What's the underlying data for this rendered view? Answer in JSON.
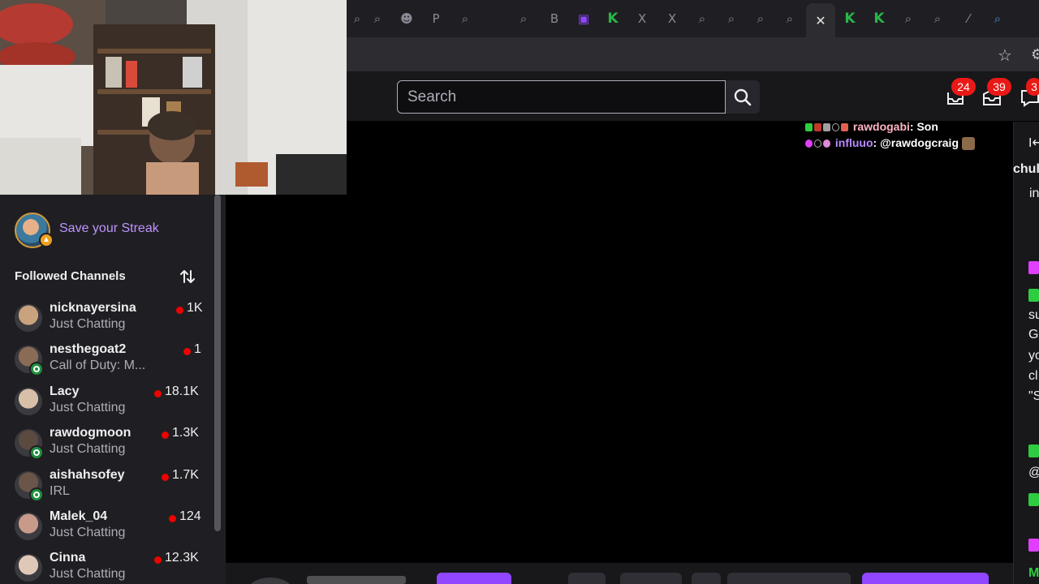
{
  "browser": {
    "tabs": [
      {
        "icon": "search-icon",
        "glyph": "⌕"
      },
      {
        "icon": "search-icon",
        "glyph": "⌕"
      },
      {
        "icon": "emoji-icon",
        "glyph": "☻"
      },
      {
        "icon": "p-icon",
        "glyph": "P"
      },
      {
        "icon": "search-icon",
        "glyph": "⌕"
      },
      {
        "icon": "search-icon",
        "glyph": "⌕"
      },
      {
        "icon": "bitcoin-icon",
        "glyph": "B"
      },
      {
        "icon": "twitch-icon",
        "glyph": "▣"
      },
      {
        "icon": "kick-icon",
        "glyph": "K"
      },
      {
        "icon": "x-icon",
        "glyph": "X"
      },
      {
        "icon": "x-icon",
        "glyph": "X"
      },
      {
        "icon": "search-icon",
        "glyph": "⌕"
      },
      {
        "icon": "search-icon",
        "glyph": "⌕"
      },
      {
        "icon": "search-icon",
        "glyph": "⌕"
      },
      {
        "icon": "search-icon",
        "glyph": "⌕"
      },
      {
        "icon": "close-icon",
        "glyph": "✕"
      },
      {
        "icon": "kick-icon",
        "glyph": "K"
      },
      {
        "icon": "kick-icon",
        "glyph": "K"
      },
      {
        "icon": "search-icon",
        "glyph": "⌕"
      },
      {
        "icon": "search-icon",
        "glyph": "⌕"
      },
      {
        "icon": "slash-icon",
        "glyph": "⁄"
      },
      {
        "icon": "search-icon",
        "glyph": "⌕"
      }
    ]
  },
  "search": {
    "placeholder": "Search"
  },
  "notifications": {
    "inbox_count": "24",
    "whispers_count": "39",
    "alerts_count": "3"
  },
  "sidebar": {
    "streak_label": "Save your Streak",
    "followed_title": "Followed Channels",
    "channels": [
      {
        "name": "nicknayersina",
        "category": "Just Chatting",
        "viewers": "1K",
        "ring": false,
        "avatar_color": "#c9a27e"
      },
      {
        "name": "nesthegoat2",
        "category": "Call of Duty: M...",
        "viewers": "1",
        "ring": true,
        "avatar_color": "#8a6b55"
      },
      {
        "name": "Lacy",
        "category": "Just Chatting",
        "viewers": "18.1K",
        "ring": false,
        "avatar_color": "#d8c0a8"
      },
      {
        "name": "rawdogmoon",
        "category": "Just Chatting",
        "viewers": "1.3K",
        "ring": true,
        "avatar_color": "#5a4a40"
      },
      {
        "name": "aishahsofey",
        "category": "IRL",
        "viewers": "1.7K",
        "ring": true,
        "avatar_color": "#6b5548"
      },
      {
        "name": "Malek_04",
        "category": "Just Chatting",
        "viewers": "124",
        "ring": false,
        "avatar_color": "#c79a8a"
      },
      {
        "name": "Cinna",
        "category": "Just Chatting",
        "viewers": "12.3K",
        "ring": false,
        "avatar_color": "#e0c8b8"
      }
    ]
  },
  "chat_overlay": {
    "messages": [
      {
        "user": "rawdogabi",
        "user_color": "#ffb3c6",
        "text": "Son"
      },
      {
        "user": "influuo",
        "user_color": "#b98cff",
        "text": "@rawdogcraig"
      }
    ]
  },
  "chat_column": {
    "fragments": [
      "I⟵",
      "chul",
      "in",
      "su",
      "G",
      "yo",
      "cl",
      "\"S",
      "@",
      "M"
    ]
  },
  "colors": {
    "accent": "#9146ff",
    "live": "#eb0400",
    "badge": "#e91916",
    "link": "#bf94ff"
  }
}
